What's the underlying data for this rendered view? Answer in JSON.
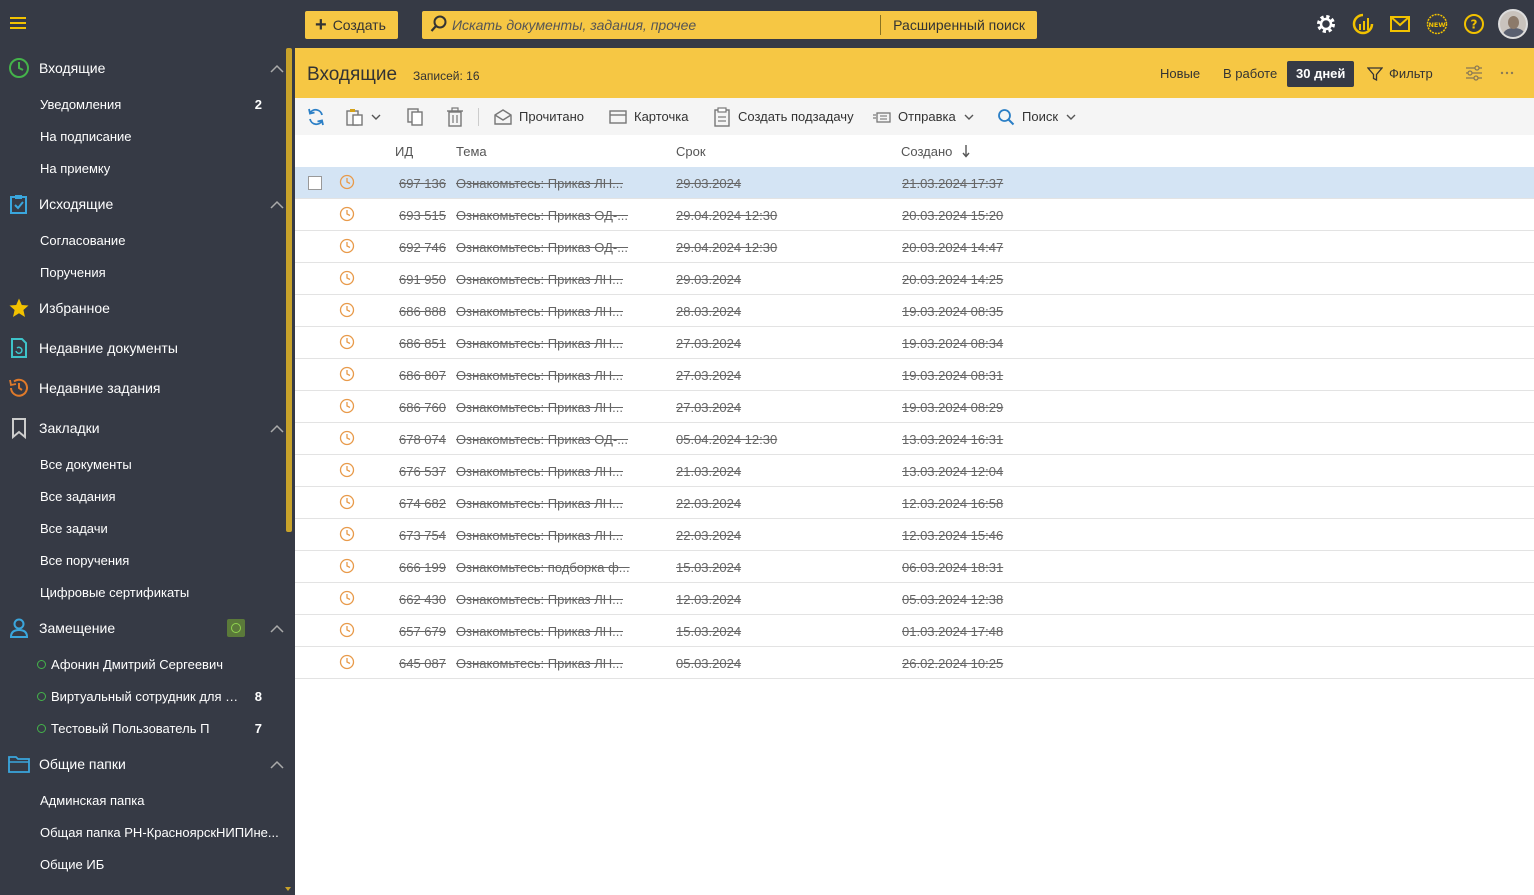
{
  "topbar": {
    "create_label": "Создать",
    "search_placeholder": "Искать документы, задания, прочее",
    "advanced_search_label": "Расширенный поиск",
    "icons": [
      "settings-icon",
      "analytics-icon",
      "mail-icon",
      "new-badge-icon",
      "help-icon",
      "avatar"
    ]
  },
  "sidebar": {
    "incoming": {
      "label": "Входящие",
      "items": [
        {
          "label": "Уведомления",
          "count": "2"
        },
        {
          "label": "На подписание",
          "count": ""
        },
        {
          "label": "На приемку",
          "count": ""
        }
      ]
    },
    "outgoing": {
      "label": "Исходящие",
      "items": [
        {
          "label": "Согласование"
        },
        {
          "label": "Поручения"
        }
      ]
    },
    "favorites": {
      "label": "Избранное"
    },
    "recent_docs": {
      "label": "Недавние документы"
    },
    "recent_tasks": {
      "label": "Недавние задания"
    },
    "bookmarks": {
      "label": "Закладки",
      "items": [
        {
          "label": "Все документы"
        },
        {
          "label": "Все задания"
        },
        {
          "label": "Все задачи"
        },
        {
          "label": "Все поручения"
        },
        {
          "label": "Цифровые сертификаты"
        }
      ]
    },
    "substitution": {
      "label": "Замещение",
      "items": [
        {
          "label": "Афонин Дмитрий Сергеевич",
          "count": ""
        },
        {
          "label": "Виртуальный сотрудник для п...",
          "count": "8"
        },
        {
          "label": "Тестовый Пользователь П",
          "count": "7"
        }
      ]
    },
    "shared": {
      "label": "Общие папки",
      "items": [
        {
          "label": "Админская папка"
        },
        {
          "label": "Общая папка РН-КрасноярскНИПИне..."
        },
        {
          "label": "Общие ИБ"
        }
      ]
    }
  },
  "header": {
    "title": "Входящие",
    "records": "Записей: 16",
    "tabs": [
      {
        "label": "Новые"
      },
      {
        "label": "В работе"
      },
      {
        "label": "30 дней"
      }
    ],
    "filter_label": "Фильтр",
    "accent_color": "#f6c744",
    "sidebar_color": "#363a45"
  },
  "toolbar": {
    "read_label": "Прочитано",
    "card_label": "Карточка",
    "subtask_label": "Создать подзадачу",
    "send_label": "Отправка",
    "search_label": "Поиск"
  },
  "grid": {
    "columns": {
      "id": "ИД",
      "subject": "Тема",
      "due": "Срок",
      "created": "Создано"
    },
    "rows": [
      {
        "id": "697 136",
        "subject": "Ознакомьтесь: Приказ ЛН...",
        "due": "29.03.2024",
        "created": "21.03.2024 17:37"
      },
      {
        "id": "693 515",
        "subject": "Ознакомьтесь: Приказ ОД-...",
        "due": "29.04.2024 12:30",
        "created": "20.03.2024 15:20"
      },
      {
        "id": "692 746",
        "subject": "Ознакомьтесь: Приказ ОД-...",
        "due": "29.04.2024 12:30",
        "created": "20.03.2024 14:47"
      },
      {
        "id": "691 950",
        "subject": "Ознакомьтесь: Приказ ЛН...",
        "due": "29.03.2024",
        "created": "20.03.2024 14:25"
      },
      {
        "id": "686 888",
        "subject": "Ознакомьтесь: Приказ ЛН...",
        "due": "28.03.2024",
        "created": "19.03.2024 08:35"
      },
      {
        "id": "686 851",
        "subject": "Ознакомьтесь: Приказ ЛН...",
        "due": "27.03.2024",
        "created": "19.03.2024 08:34"
      },
      {
        "id": "686 807",
        "subject": "Ознакомьтесь: Приказ ЛН...",
        "due": "27.03.2024",
        "created": "19.03.2024 08:31"
      },
      {
        "id": "686 760",
        "subject": "Ознакомьтесь: Приказ ЛН...",
        "due": "27.03.2024",
        "created": "19.03.2024 08:29"
      },
      {
        "id": "678 074",
        "subject": "Ознакомьтесь: Приказ ОД-...",
        "due": "05.04.2024 12:30",
        "created": "13.03.2024 16:31"
      },
      {
        "id": "676 537",
        "subject": "Ознакомьтесь: Приказ ЛН...",
        "due": "21.03.2024",
        "created": "13.03.2024 12:04"
      },
      {
        "id": "674 682",
        "subject": "Ознакомьтесь: Приказ ЛН...",
        "due": "22.03.2024",
        "created": "12.03.2024 16:58"
      },
      {
        "id": "673 754",
        "subject": "Ознакомьтесь: Приказ ЛН...",
        "due": "22.03.2024",
        "created": "12.03.2024 15:46"
      },
      {
        "id": "666 199",
        "subject": "Ознакомьтесь: подборка ф...",
        "due": "15.03.2024",
        "created": "06.03.2024 18:31"
      },
      {
        "id": "662 430",
        "subject": "Ознакомьтесь: Приказ ЛН...",
        "due": "12.03.2024",
        "created": "05.03.2024 12:38"
      },
      {
        "id": "657 679",
        "subject": "Ознакомьтесь: Приказ ЛН...",
        "due": "15.03.2024",
        "created": "01.03.2024 17:48"
      },
      {
        "id": "645 087",
        "subject": "Ознакомьтесь: Приказ ЛН...",
        "due": "05.03.2024",
        "created": "26.02.2024 10:25"
      }
    ]
  }
}
